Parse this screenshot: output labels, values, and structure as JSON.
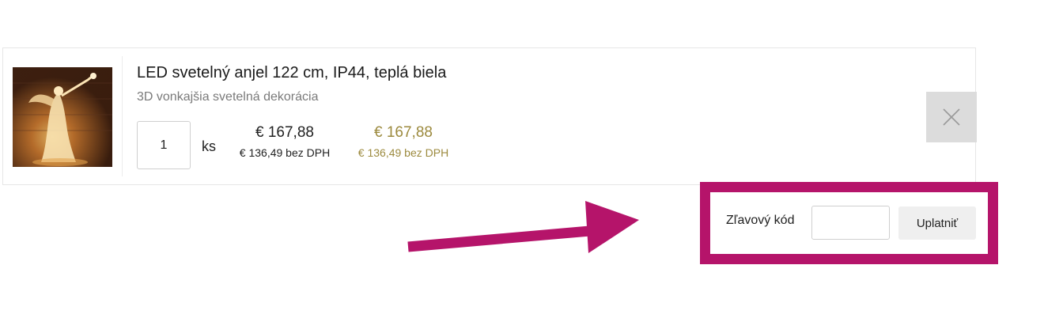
{
  "cart_item": {
    "image_alt": "LED svetelný anjel",
    "title": "LED svetelný anjel 122 cm, IP44, teplá biela",
    "subtitle": "3D vonkajšia svetelná dekorácia",
    "quantity": "1",
    "unit": "ks",
    "unit_price": "€ 167,88",
    "unit_price_net": "€ 136,49 bez DPH",
    "total_price": "€ 167,88",
    "total_price_net": "€ 136,49 bez DPH",
    "remove_icon": "close-icon"
  },
  "coupon": {
    "label": "Zľavový kód",
    "input_value": "",
    "button_label": "Uplatniť"
  },
  "colors": {
    "highlight": "#b5146a",
    "total_price": "#9c8a3e",
    "remove_bg": "#dcdcdc"
  }
}
